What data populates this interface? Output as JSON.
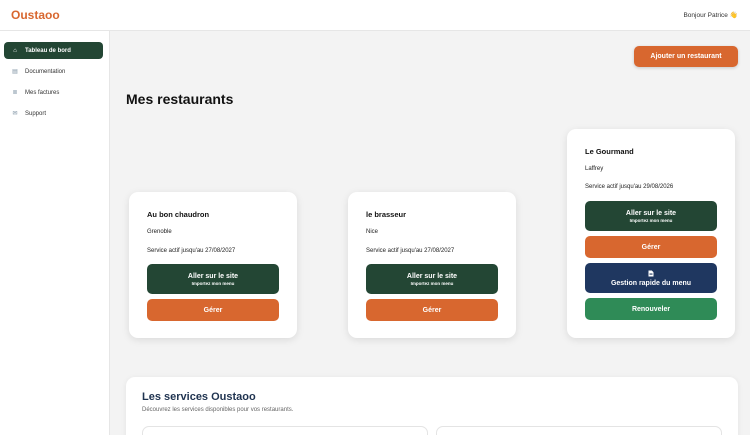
{
  "header": {
    "brand": "Oustaoo",
    "greeting": "Bonjour Patrice",
    "greeting_emoji": "👋"
  },
  "sidebar": {
    "items": [
      {
        "label": "Tableau de bord",
        "icon": "home-icon",
        "glyph": "⌂",
        "active": true
      },
      {
        "label": "Documentation",
        "icon": "book-icon",
        "glyph": "▤",
        "active": false
      },
      {
        "label": "Mes factures",
        "icon": "invoice-icon",
        "glyph": "≣",
        "active": false
      },
      {
        "label": "Support",
        "icon": "support-icon",
        "glyph": "✉",
        "active": false
      }
    ]
  },
  "main": {
    "add_button": "Ajouter un restaurant",
    "title": "Mes restaurants",
    "restaurants": [
      {
        "name": "Au bon chaudron",
        "city": "Grenoble",
        "status": "Service actif jusqu'au 27/08/2027",
        "visit_label": "Aller sur le site",
        "visit_sub": "Importez mon menu",
        "manage_label": "Gérer"
      },
      {
        "name": "le brasseur",
        "city": "Nice",
        "status": "Service actif jusqu'au 27/08/2027",
        "visit_label": "Aller sur le site",
        "visit_sub": "Importez mon menu",
        "manage_label": "Gérer"
      },
      {
        "name": "Le Gourmand",
        "city": "Laffrey",
        "status": "Service actif jusqu'au 29/08/2026",
        "visit_label": "Aller sur le site",
        "visit_sub": "Importez mon menu",
        "manage_label": "Gérer",
        "menu_label": "Gestion rapide du menu",
        "renew_label": "Renouveler"
      }
    ]
  },
  "services": {
    "title": "Les services Oustaoo",
    "subtitle": "Découvrez les services disponibles pour vos restaurants."
  },
  "colors": {
    "brand": "#d8672f",
    "primary_green": "#234634",
    "navy": "#1f3760",
    "renew_green": "#2f8b57"
  }
}
